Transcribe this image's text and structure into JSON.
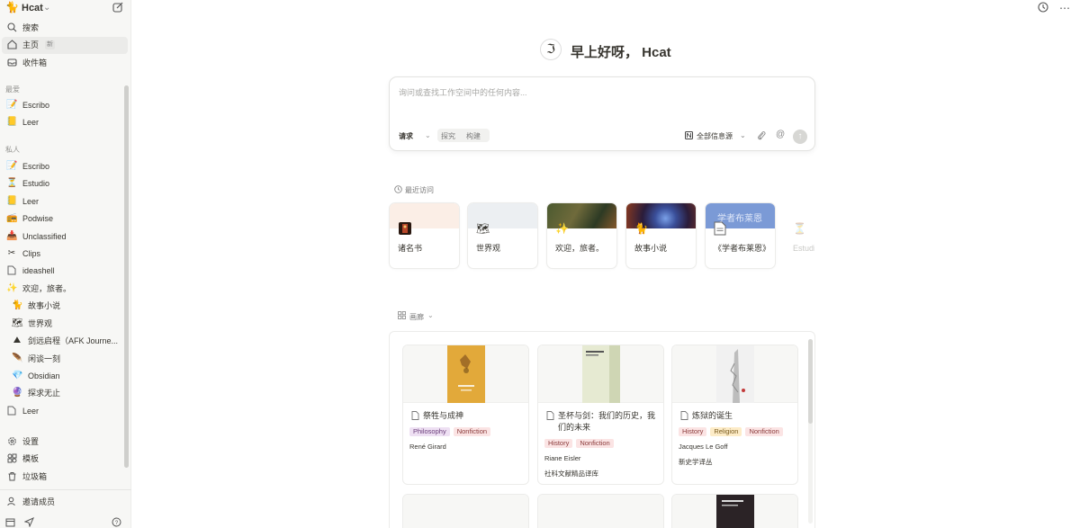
{
  "workspace": {
    "name": "Hcat",
    "logo_icon": "cat-icon"
  },
  "sidebar": {
    "top_items": [
      {
        "label": "搜索",
        "icon": "search-icon"
      },
      {
        "label": "主页",
        "icon": "home-icon",
        "badge": "新",
        "active": true
      },
      {
        "label": "收件箱",
        "icon": "inbox-icon"
      }
    ],
    "favorites_label": "最爱",
    "favorites": [
      {
        "label": "Escribo",
        "icon": "memo-icon"
      },
      {
        "label": "Leer",
        "icon": "ledger-icon"
      }
    ],
    "private_label": "私人",
    "private": [
      {
        "label": "Escribo",
        "icon": "memo-icon"
      },
      {
        "label": "Estudio",
        "icon": "hourglass-icon"
      },
      {
        "label": "Leer",
        "icon": "ledger-icon"
      },
      {
        "label": "Podwise",
        "icon": "podcast-icon"
      },
      {
        "label": "Unclassified",
        "icon": "inbox-tray-icon"
      },
      {
        "label": "Clips",
        "icon": "scissors-icon"
      },
      {
        "label": "ideashell",
        "icon": "page-icon"
      },
      {
        "label": "欢迎，旅者。",
        "icon": "sparkles-icon"
      },
      {
        "label": "故事小说",
        "icon": "cat-icon"
      },
      {
        "label": "世界观",
        "icon": "map-icon"
      },
      {
        "label": "剑远启程（AFK Journe...",
        "icon": "mountain-icon"
      },
      {
        "label": "闲谈一刻",
        "icon": "feather-icon"
      },
      {
        "label": "Obsidian",
        "icon": "obsidian-icon"
      },
      {
        "label": "探求无止",
        "icon": "crystal-icon"
      },
      {
        "label": "Leer",
        "icon": "page-icon"
      }
    ],
    "utility": [
      {
        "label": "设置",
        "icon": "gear-icon"
      },
      {
        "label": "模板",
        "icon": "template-icon"
      },
      {
        "label": "垃圾箱",
        "icon": "trash-icon"
      }
    ],
    "invite_label": "邀请成员"
  },
  "greeting": {
    "text": "早上好呀， Hcat"
  },
  "search": {
    "placeholder": "询问或查找工作空间中的任何内容...",
    "mode_ask": "请求",
    "mode_explore": "探究",
    "mode_build": "构建",
    "source_label": "全部信息源"
  },
  "recent": {
    "label": "最近访问",
    "cards": [
      {
        "title": "诸名书",
        "icon": "book-icon",
        "cover_color": "#fbeee6"
      },
      {
        "title": "世界观",
        "icon": "map-icon",
        "cover_color": "#eceff2"
      },
      {
        "title": "欢迎，旅者。",
        "icon": "sparkles-icon",
        "cover_color": "#3b4a2c"
      },
      {
        "title": "故事小说",
        "icon": "cat-icon",
        "cover_color": "#2a1c3a"
      },
      {
        "title": "《学者布莱恩》",
        "icon": "page-icon",
        "cover_color": "#7b9ad6",
        "cover_text": "学者布莱恩"
      },
      {
        "title": "Estudio",
        "icon": "hourglass-icon",
        "cover_color": "#ffffff"
      }
    ]
  },
  "gallery": {
    "label": "画廊",
    "cards": [
      {
        "title": "祭牲与成神",
        "tags": [
          {
            "text": "Philosophy",
            "kind": "philo"
          },
          {
            "text": "Nonfiction",
            "kind": "nonfic"
          }
        ],
        "author": "René Girard",
        "publisher": "",
        "book_color": "#e2a93a"
      },
      {
        "title": "圣杯与剑：我们的历史，我们的未来",
        "tags": [
          {
            "text": "History",
            "kind": "hist"
          },
          {
            "text": "Nonfiction",
            "kind": "nonfic"
          }
        ],
        "author": "Riane Eisler",
        "publisher": "社科文献精品译库",
        "book_color": "#e6ead2"
      },
      {
        "title": "炼狱的诞生",
        "tags": [
          {
            "text": "History",
            "kind": "hist"
          },
          {
            "text": "Religion",
            "kind": "rel"
          },
          {
            "text": "Nonfiction",
            "kind": "nonfic"
          }
        ],
        "author": "Jacques Le Goff",
        "publisher": "新史学译丛",
        "book_color": "#f1f1f1"
      }
    ]
  },
  "colors": {
    "sidebar_bg": "#f7f7f5",
    "text": "#37352f",
    "muted": "#91918e"
  }
}
